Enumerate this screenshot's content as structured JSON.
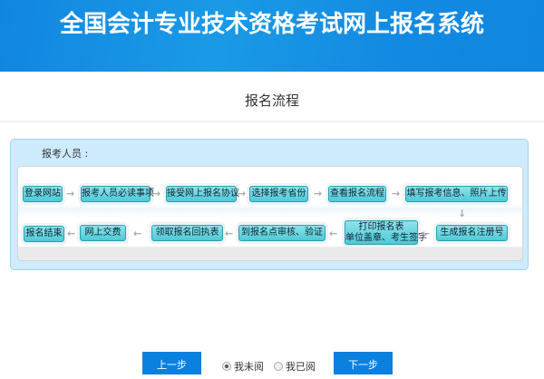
{
  "header": {
    "title": "全国会计专业技术资格考试网上报名系统"
  },
  "page_title": "报名流程",
  "flow": {
    "label": "报考人员 :",
    "row1": [
      "登录网站",
      "报考人员必读事项",
      "接受网上报名协议",
      "选择报考省份",
      "查看报名流程",
      "填写报考信息、照片上传"
    ],
    "row2": [
      "报名结束",
      "网上交费",
      "领取报名回执表",
      "到报名点审核、验证",
      "打印报名表",
      "生成报名注册号"
    ],
    "print_sub": "单位盖章、考生签字"
  },
  "footer": {
    "prev": "上一步",
    "next": "下一步",
    "radio_unread": "我未阅",
    "radio_read": "我已阅",
    "selected": "我未阅"
  },
  "colors": {
    "header": "#1186e0",
    "button": "#0a80df",
    "step": "#4ccad6"
  }
}
